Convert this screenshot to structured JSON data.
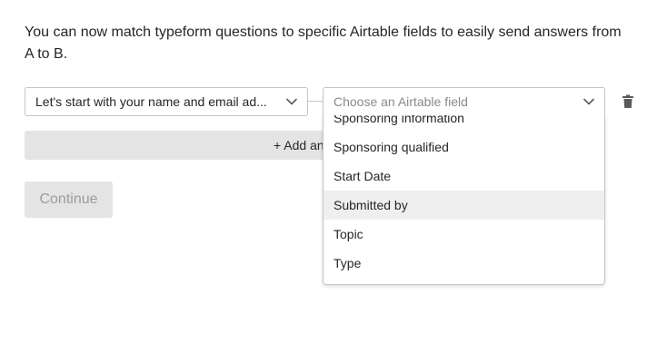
{
  "intro_text": "You can now match typeform questions to specific Airtable fields to easily send answers from A to B.",
  "question_select": {
    "value": "Let's start with your name and email ad..."
  },
  "airtable_select": {
    "placeholder": "Choose an Airtable field"
  },
  "add_answer_label": "+ Add an",
  "continue_label": "Continue",
  "dropdown": {
    "options": [
      "Sponsoring information",
      "Sponsoring qualified",
      "Start Date",
      "Submitted by",
      "Topic",
      "Type"
    ],
    "highlighted_index": 3
  },
  "icons": {
    "chevron": "chevron-down-icon",
    "trash": "trash-icon"
  },
  "colors": {
    "text": "#262627",
    "border": "#c4c4c4",
    "button_disabled_bg": "#e4e4e4",
    "highlight_bg": "#efefef"
  }
}
